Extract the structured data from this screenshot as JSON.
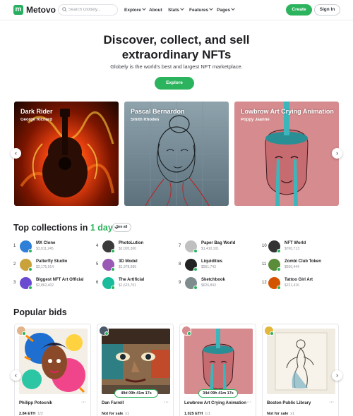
{
  "header": {
    "logo_letter": "m",
    "logo_text": "Metovo",
    "search_placeholder": "Search Globely...",
    "nav": [
      "Explore",
      "About",
      "Stats",
      "Features",
      "Pages"
    ],
    "create_label": "Create",
    "signin_label": "Sign In"
  },
  "hero": {
    "title_line1": "Discover, collect, and sell",
    "title_line2": "extraordinary NFTs",
    "subtitle": "Globely is the world's best and largest NFT marketplace.",
    "button_label": "Explore"
  },
  "featured": [
    {
      "title": "Dark Rider",
      "author": "George Richard"
    },
    {
      "title": "Pascal Bernardon",
      "author": "Smith Rhodes"
    },
    {
      "title": "Lowbrow Art Crying Animation",
      "author": "Poppy Jaanne"
    }
  ],
  "collections": {
    "title": "Top collections in",
    "period": "1 day",
    "see_all": "See all",
    "items": [
      {
        "rank": "1",
        "name": "MX Clone",
        "price": "$3,011,245"
      },
      {
        "rank": "2",
        "name": "Patterfly Studio",
        "price": "$3,175,914"
      },
      {
        "rank": "3",
        "name": "Biggest NFT Art Official",
        "price": "$2,862,402"
      },
      {
        "rank": "4",
        "name": "PhotoLution",
        "price": "$2,005,300"
      },
      {
        "rank": "5",
        "name": "3D Model",
        "price": "$1,978,989"
      },
      {
        "rank": "6",
        "name": "The Artificial",
        "price": "$1,623,701"
      },
      {
        "rank": "7",
        "name": "Paper Bag World",
        "price": "$1,410,101"
      },
      {
        "rank": "8",
        "name": "Liquidities",
        "price": "$951,743"
      },
      {
        "rank": "9",
        "name": "Sketchbook",
        "price": "$626,843"
      },
      {
        "rank": "10",
        "name": "NFT World",
        "price": "$700,713"
      },
      {
        "rank": "11",
        "name": "Zombi Club Token",
        "price": "$650,444"
      },
      {
        "rank": "12",
        "name": "Tattoo Girl Art",
        "price": "$221,416"
      }
    ]
  },
  "bids": {
    "title": "Popular bids",
    "items": [
      {
        "title": "Philipp Potocnik",
        "price": "2.84 ETH",
        "qty": "1/2",
        "timer": ""
      },
      {
        "title": "Dan Farrell",
        "price": "Not for sale",
        "qty": "x1",
        "timer": "49d 09h 41m 17s"
      },
      {
        "title": "Lowbrow Art Crying Animation",
        "price": "1.025 ETH",
        "qty": "1/1",
        "timer": "34d 09h 41m 17s"
      },
      {
        "title": "Boston Public Library",
        "price": "Not for sale",
        "qty": "x1",
        "timer": ""
      }
    ]
  },
  "colors": {
    "accent": "#2cb35d",
    "text": "#1e1f23",
    "muted": "#8a8f98"
  }
}
